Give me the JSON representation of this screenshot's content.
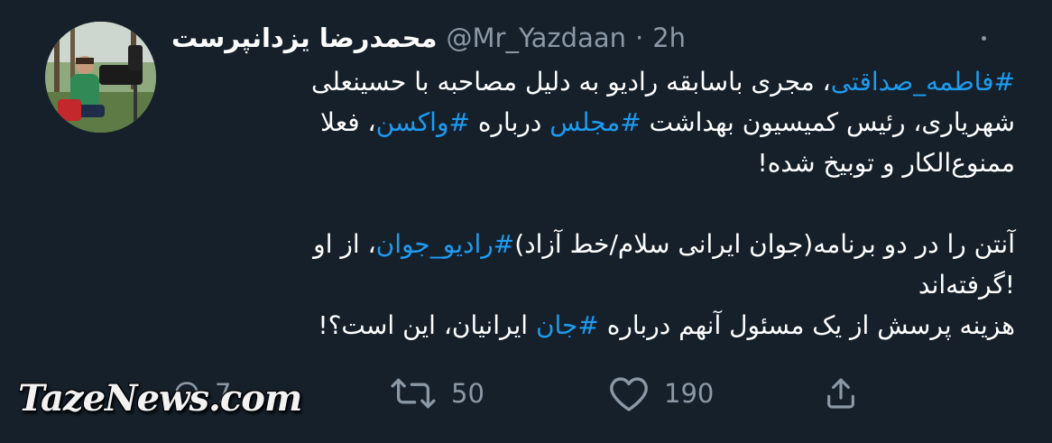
{
  "tweet": {
    "author": {
      "display_name": "محمدرضا یزدانپرست",
      "handle": "@Mr_Yazdaan",
      "separator": "·",
      "time": "2h"
    },
    "more_icon": "more-horizontal-icon",
    "lines": [
      [
        {
          "text": "#فاطمه_صداقتی",
          "tag": true
        },
        {
          "text": "، مجری باسابقه رادیو به دلیل مصاحبه با حسینعلی",
          "tag": false
        }
      ],
      [
        {
          "text": "شهریاری، رئیس کمیسیون بهداشت ",
          "tag": false
        },
        {
          "text": "#مجلس",
          "tag": true
        },
        {
          "text": " درباره ",
          "tag": false
        },
        {
          "text": "#واکسن",
          "tag": true
        },
        {
          "text": "، فعلا",
          "tag": false
        }
      ],
      [
        {
          "text": "ممنوع‌الکار و توبیخ شده!",
          "tag": false
        }
      ],
      [],
      [
        {
          "text": "آنتن را در دو برنامه(جوان ایرانی سلام/خط آزاد)",
          "tag": false
        },
        {
          "text": "#رادیو_جوان",
          "tag": true
        },
        {
          "text": "، از او",
          "tag": false
        }
      ],
      [
        {
          "text": "!گرفته‌اند",
          "tag": false
        }
      ],
      [
        {
          "text": "هزینه پرسش از یک مسئول آنهم درباره ",
          "tag": false
        },
        {
          "text": "#جان",
          "tag": true
        },
        {
          "text": " ایرانیان، این است؟!",
          "tag": false
        }
      ]
    ],
    "actions": {
      "reply": {
        "icon": "reply-icon",
        "count": "7"
      },
      "retweet": {
        "icon": "retweet-icon",
        "count": "50"
      },
      "like": {
        "icon": "heart-icon",
        "count": "190"
      },
      "share": {
        "icon": "share-icon",
        "count": ""
      }
    }
  },
  "watermark": {
    "text": "TazeNews.com"
  },
  "colors": {
    "background": "#15202b",
    "text": "#ffffff",
    "secondary": "#8b98a5",
    "hashtag": "#1d9bf0"
  }
}
